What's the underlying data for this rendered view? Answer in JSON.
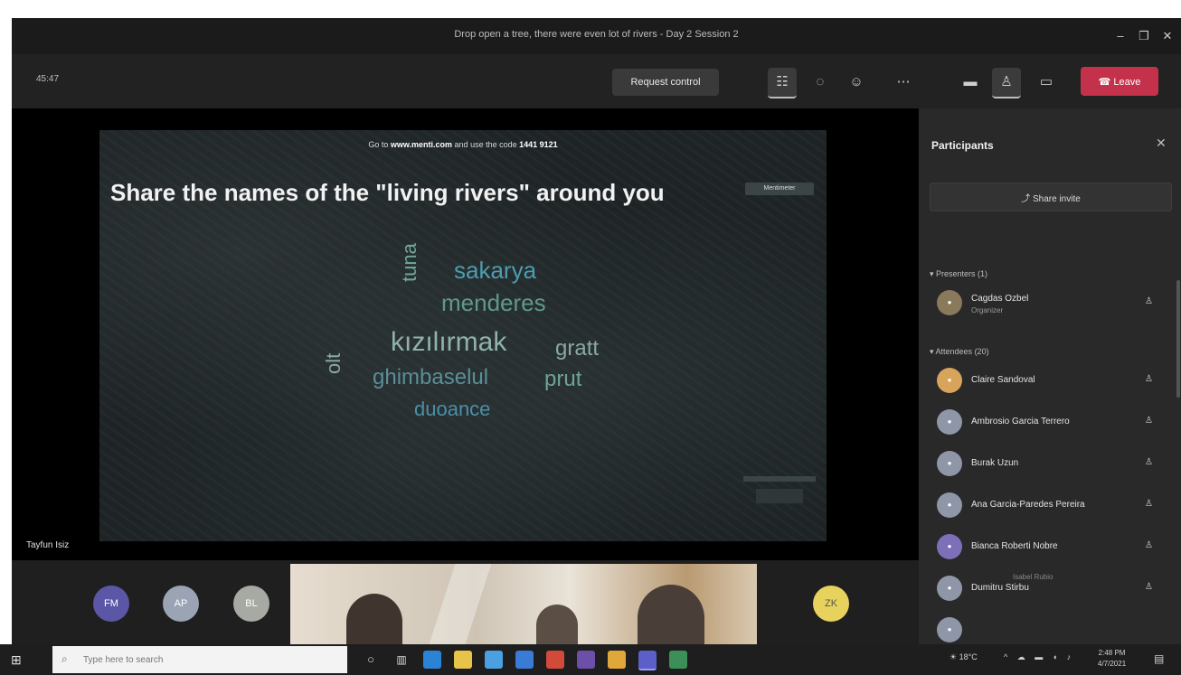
{
  "window": {
    "title": "Drop open a tree, there were even lot of rivers - Day 2 Session 2"
  },
  "toolbar": {
    "timer": "45:47",
    "request_control": "Request control",
    "leave": "Leave",
    "icons": [
      "participants-icon",
      "chat-icon",
      "reactions-icon",
      "more-icon",
      "camera-icon",
      "mic-icon",
      "share-icon"
    ]
  },
  "slide": {
    "join_prefix": "Go to ",
    "join_site": "www.menti.com",
    "join_mid": " and use the code ",
    "join_code": "1441 9121",
    "question": "Share the names of the \"living rivers\" around you",
    "badge": "Mentimeter",
    "words": [
      {
        "text": "kızılırmak",
        "color": "#8fb3a8"
      },
      {
        "text": "sakarya",
        "color": "#4c9db0"
      },
      {
        "text": "menderes",
        "color": "#5f9a86"
      },
      {
        "text": "ghimbaselul",
        "color": "#5a8f98"
      },
      {
        "text": "prut",
        "color": "#6ea398"
      },
      {
        "text": "gratt",
        "color": "#8aa9a0"
      },
      {
        "text": "duoance",
        "color": "#4b8fa8"
      },
      {
        "text": "tuna",
        "color": "#6fa89a"
      },
      {
        "text": "olt",
        "color": "#8aa9a0"
      }
    ]
  },
  "stage": {
    "speaker": "Tayfun Isiz"
  },
  "gallery": {
    "avatars": [
      "FM",
      "AP",
      "BL",
      "ZK"
    ]
  },
  "panel": {
    "title": "Participants",
    "share_invite": "Share invite",
    "presenters_label": "Presenters (1)",
    "attendees_label": "Attendees (20)",
    "presenter": {
      "name": "Cagdas Ozbel",
      "role": "Organizer"
    },
    "attendees": [
      {
        "name": "Claire Sandoval"
      },
      {
        "name": "Ambrosio Garcia Terrero"
      },
      {
        "name": "Burak Uzun"
      },
      {
        "name": "Ana Garcia-Paredes Pereira"
      },
      {
        "name": "Bianca Roberti Nobre"
      },
      {
        "name": "Dumitru Stirbu",
        "sub": "Isabel Rubio"
      }
    ]
  },
  "taskbar": {
    "search_placeholder": "Type here to search",
    "time": "2:48 PM",
    "date": "4/7/2021",
    "temp": "18°C"
  },
  "colors": {
    "leave": "#c4314b",
    "panel": "#292929",
    "stage": "#000000"
  }
}
